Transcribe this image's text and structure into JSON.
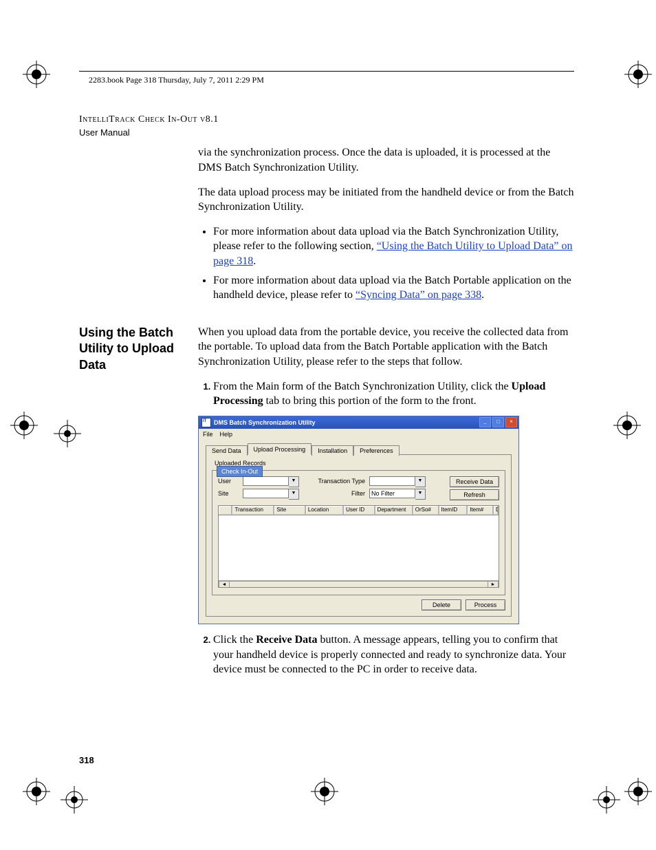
{
  "crop": {
    "text": "2283.book  Page 318  Thursday, July 7, 2011  2:29 PM"
  },
  "header": {
    "title": "IntelliTrack Check In-Out v8.1",
    "subtitle": "User Manual"
  },
  "section1": {
    "p1": "via the synchronization process. Once the data is uploaded, it is processed at the DMS Batch Synchronization Utility.",
    "p2": "The data upload process may be initiated from the handheld device or from the Batch Synchronization Utility.",
    "bullet1_pre": "For more information about data upload via the Batch Synchronization Utility, please refer to the following section, ",
    "bullet1_link": "“Using the Batch Utility to Upload Data” on page 318",
    "bullet1_post": ".",
    "bullet2_pre": "For more information about data upload via the Batch Portable application on the handheld device, please refer to ",
    "bullet2_link": "“Syncing Data” on page 338",
    "bullet2_post": "."
  },
  "section2": {
    "heading": "Using the Batch Utility to Upload Data",
    "intro": "When you upload data from the portable device, you receive the collected data from the portable. To upload data from the Batch Portable application with the Batch Synchronization Utility, please refer to the steps that follow.",
    "step1_pre": "From the Main form of the Batch Synchronization Utility, click the ",
    "step1_bold": "Upload Processing",
    "step1_post": " tab to bring this portion of the form to the front.",
    "step2_pre": "Click the ",
    "step2_bold": "Receive Data",
    "step2_post": " button. A message appears, telling you to  confirm that your handheld device is properly connected and ready to synchronize data. Your device must be connected to the PC in order to receive data."
  },
  "app": {
    "title": "DMS Batch Synchronization Utility",
    "menu": {
      "file": "File",
      "help": "Help"
    },
    "tabs": {
      "t1": "Send Data",
      "t2": "Upload Processing",
      "t3": "Installation",
      "t4": "Preferences"
    },
    "panel_sub": "Uploaded Records",
    "legend": "Check In-Out",
    "labels": {
      "user": "User",
      "site": "Site",
      "txtype": "Transaction Type",
      "filter": "Filter"
    },
    "fields": {
      "user": "",
      "site": "",
      "txtype": "",
      "filter": "No Filter"
    },
    "buttons": {
      "receive": "Receive Data",
      "refresh": "Refresh",
      "delete": "Delete",
      "process": "Process"
    },
    "columns": {
      "c0": "",
      "c1": "Transaction",
      "c2": "Site",
      "c3": "Location",
      "c4": "User ID",
      "c5": "Department",
      "c6": "OrSo#",
      "c7": "ItemID",
      "c8": "Item#",
      "c9": "Descrip"
    }
  },
  "page_number": "318"
}
